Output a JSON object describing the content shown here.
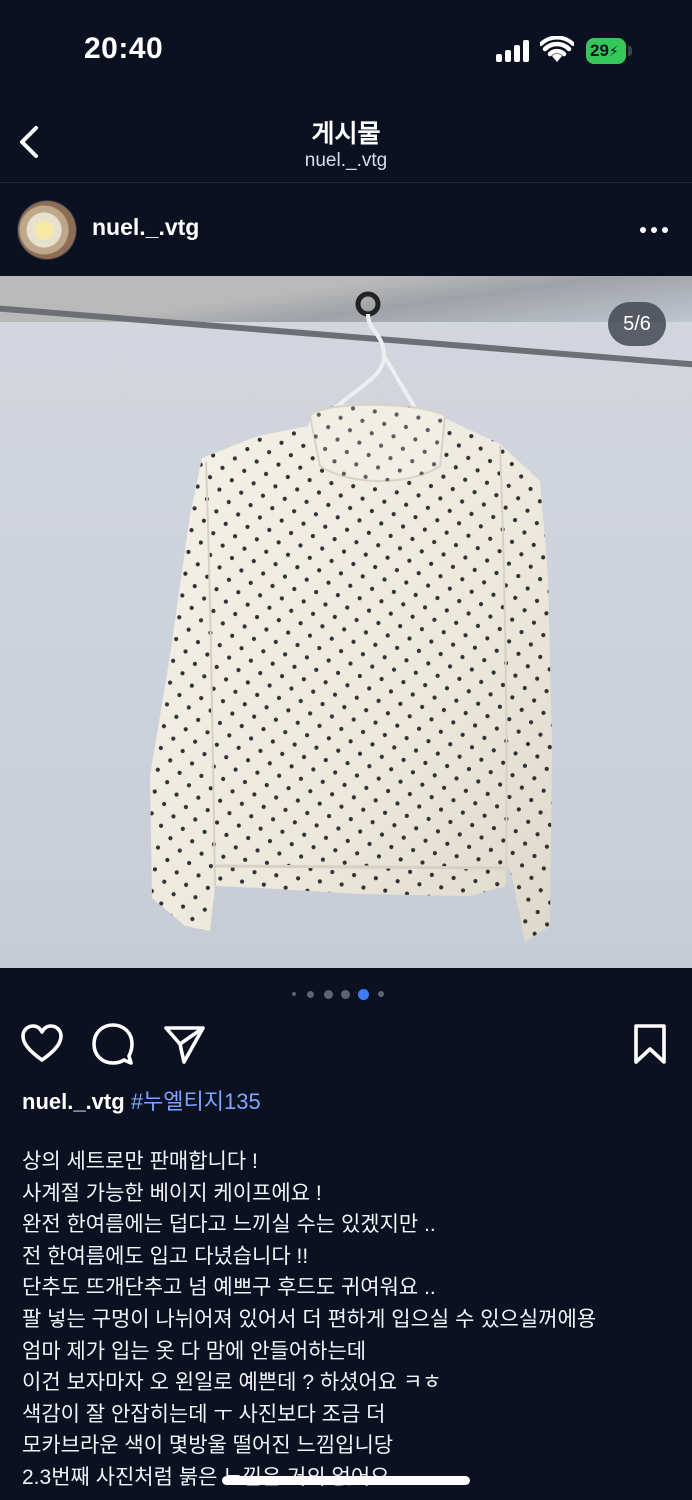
{
  "status_bar": {
    "time": "20:40",
    "battery_level": "29"
  },
  "header": {
    "title": "게시물",
    "subtitle": "nuel._.vtg",
    "back_icon": "chevron-left-icon"
  },
  "post": {
    "author": "nuel._.vtg",
    "more_icon": "more-horizontal-icon",
    "image_counter": "5/6",
    "image_index": 5,
    "image_count": 6,
    "image_description_icon": "photo",
    "actions": [
      "heart-icon",
      "comment-icon",
      "share-icon",
      "bookmark-icon"
    ],
    "caption_user": "nuel._.vtg",
    "caption_tag": "#누엘티지135",
    "caption_lines": [
      "상의 세트로만 판매합니다 !",
      "사계절 가능한 베이지 케이프에요 !",
      "완전 한여름에는 덥다고 느끼실 수는 있겠지만 ..",
      "전 한여름에도 입고 다녔습니다 !!",
      "단추도 뜨개단추고 넘 예쁘구 후드도 귀여워요 ..",
      "팔 넣는 구멍이 나뉘어져 있어서 더 편하게 입으실 수 있으실꺼에용",
      "엄마 제가 입는 옷 다 맘에 안들어하는데",
      "이건 보자마자 오 왼일로 예쁜데 ? 하셨어요 ㅋㅎ",
      "색감이 잘 안잡히는데 ㅜ 사진보다 조금 더",
      "모카브라운 색이 몇방울 떨어진 느낌입니당",
      "2.3번째 사진처럼 붉은 느낌은 거의 없어요"
    ]
  },
  "colors": {
    "background": "#0b1120",
    "hashtag": "#7ea6ff",
    "battery": "#35c759"
  }
}
